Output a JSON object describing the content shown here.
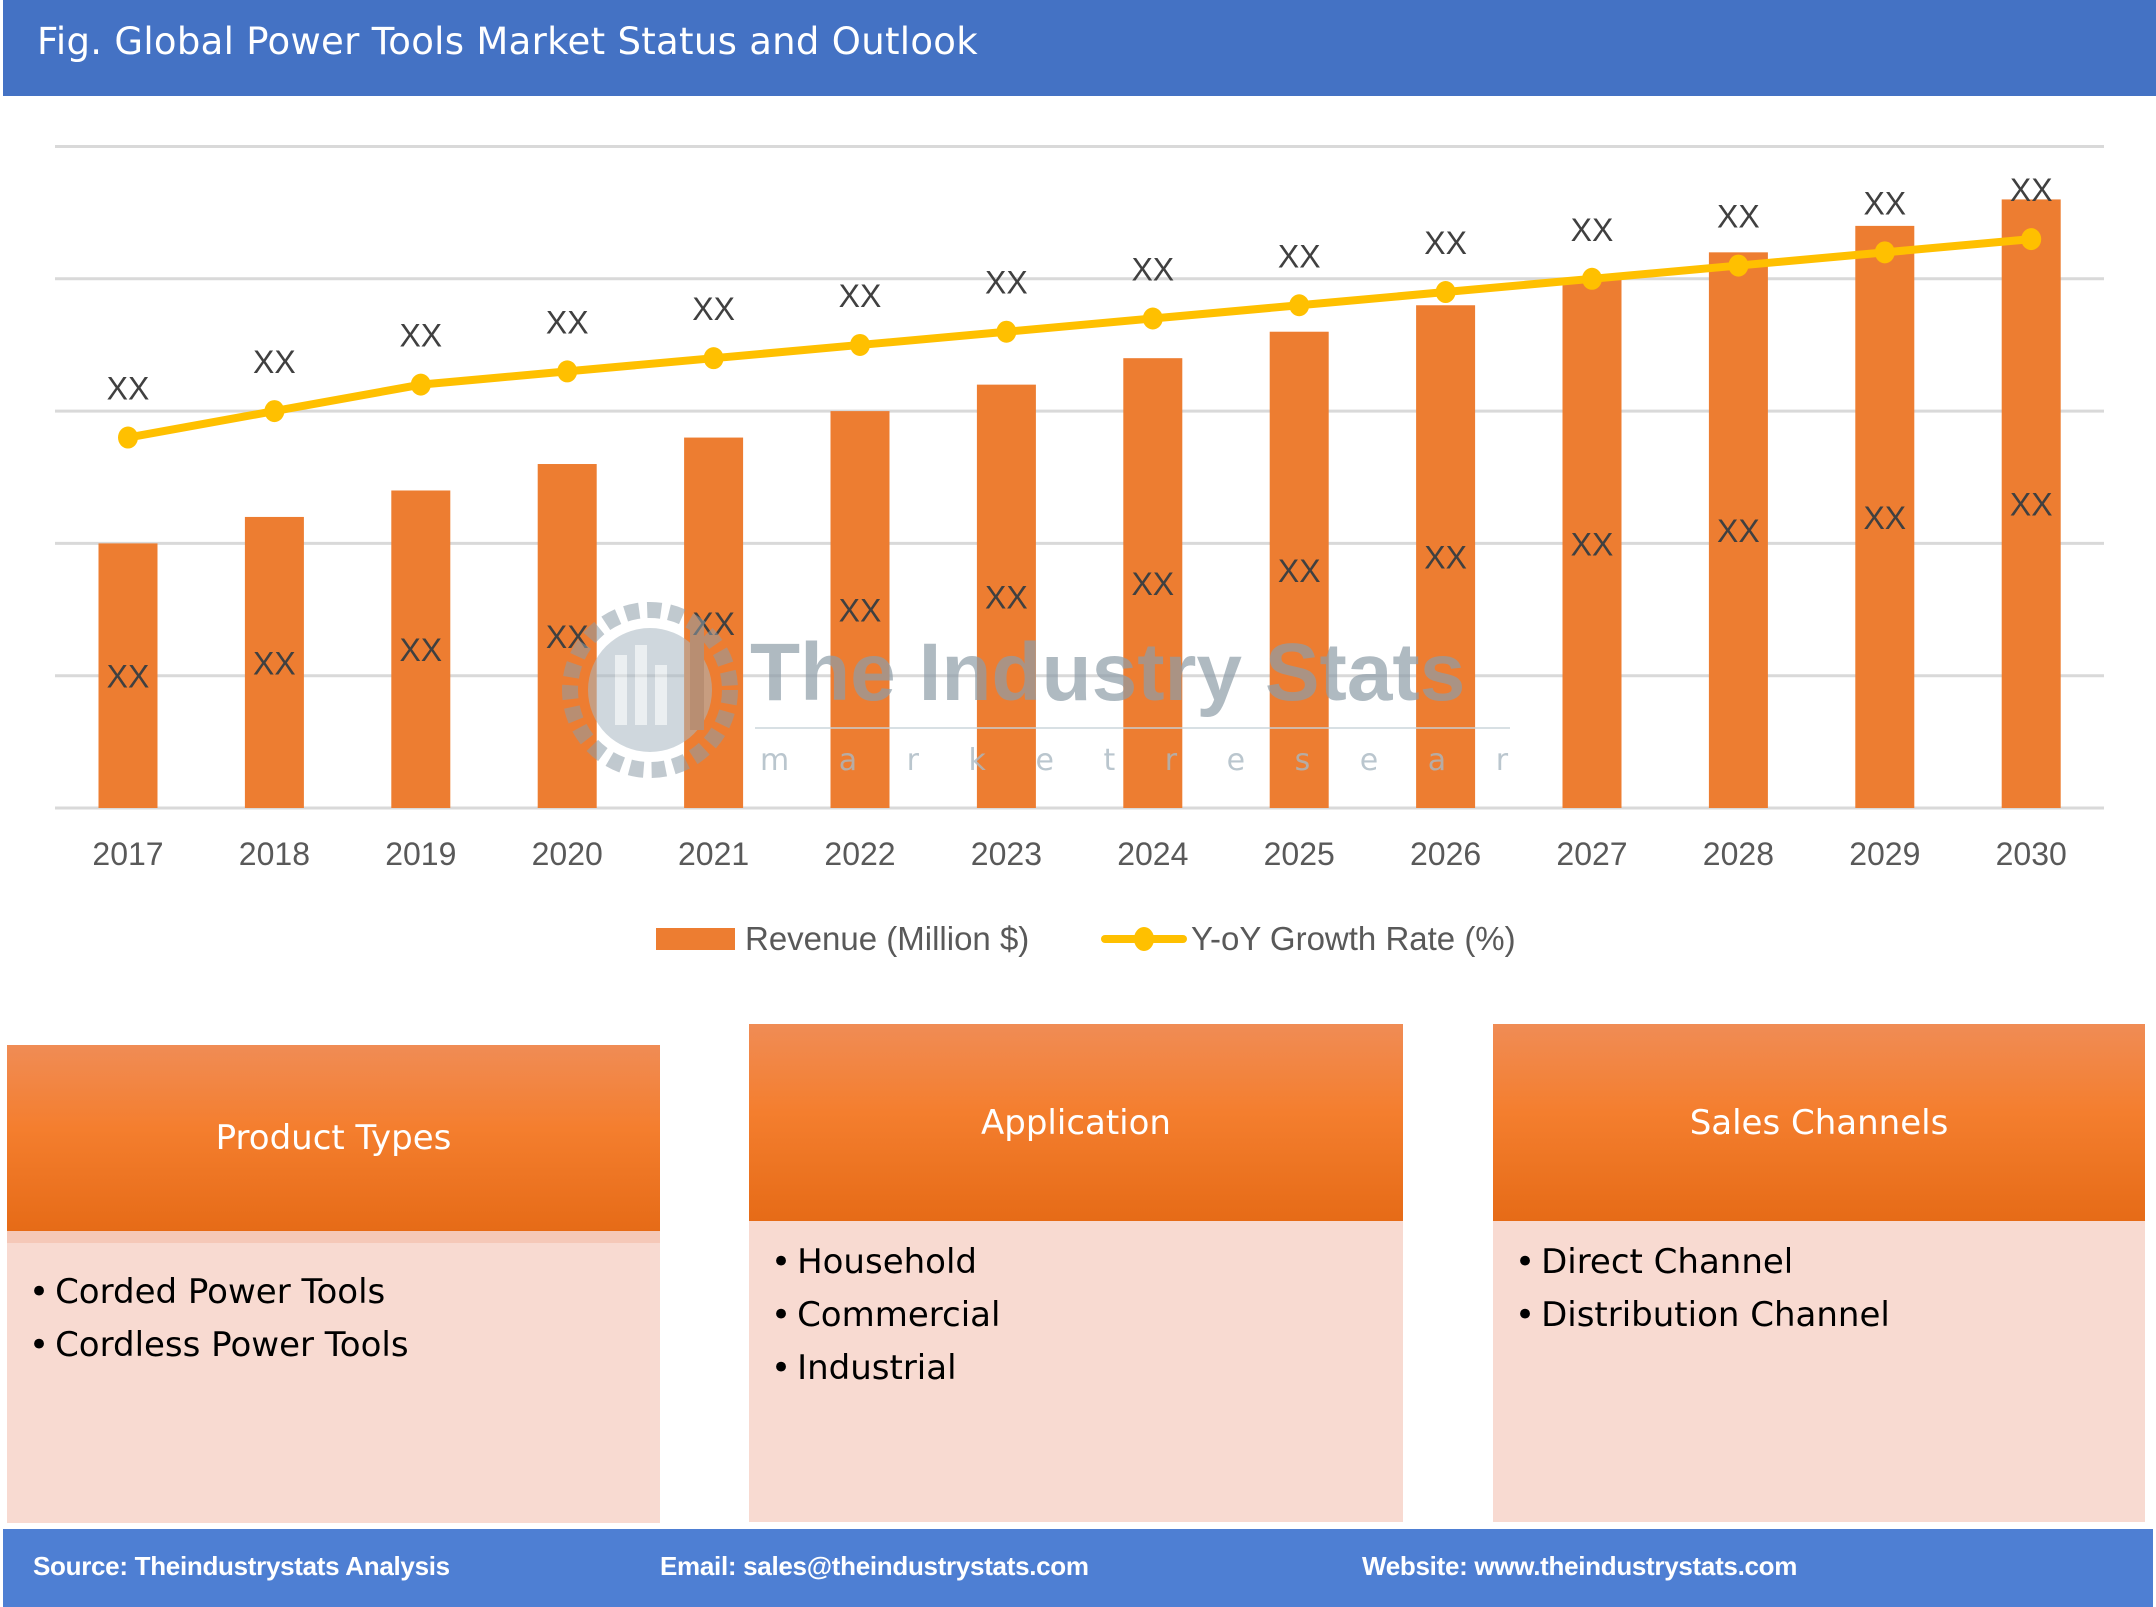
{
  "header": {
    "title": "Fig. Global Power Tools Market Status and Outlook"
  },
  "colors": {
    "header_bg": "#4472C4",
    "bar": "#ED7D31",
    "line": "#FFC000",
    "gridline": "#D9D9D9",
    "segment_body": "#F8DAD1",
    "footer_bg": "#4E7FD3"
  },
  "chart_data": {
    "type": "bar",
    "title": "",
    "xlabel": "",
    "ylabel": "",
    "categories": [
      "2017",
      "2018",
      "2019",
      "2020",
      "2021",
      "2022",
      "2023",
      "2024",
      "2025",
      "2026",
      "2027",
      "2028",
      "2029",
      "2030"
    ],
    "units_note": "Values hidden as XX; estimated in relative gridline units (baseline 0, 5 gridlines above)",
    "ylim": [
      0,
      5
    ],
    "grid": true,
    "legend_position": "bottom",
    "series": [
      {
        "name": "Revenue (Million $)",
        "type": "bar",
        "values": [
          2.0,
          2.2,
          2.4,
          2.6,
          2.8,
          3.0,
          3.2,
          3.4,
          3.6,
          3.8,
          4.0,
          4.2,
          4.4,
          4.6
        ],
        "labels": [
          "XX",
          "XX",
          "XX",
          "XX",
          "XX",
          "XX",
          "XX",
          "XX",
          "XX",
          "XX",
          "XX",
          "XX",
          "XX",
          "XX"
        ]
      },
      {
        "name": "Y-oY Growth Rate (%)",
        "type": "line",
        "values": [
          2.8,
          3.0,
          3.2,
          3.3,
          3.4,
          3.5,
          3.6,
          3.7,
          3.8,
          3.9,
          4.0,
          4.1,
          4.2,
          4.3
        ],
        "labels": [
          "XX",
          "XX",
          "XX",
          "XX",
          "XX",
          "XX",
          "XX",
          "XX",
          "XX",
          "XX",
          "XX",
          "XX",
          "XX",
          "XX"
        ]
      }
    ]
  },
  "legend": {
    "bar_label": "Revenue (Million $)",
    "line_label": "Y-oY Growth Rate (%)"
  },
  "watermark": {
    "name": "The Industry Stats",
    "tagline": "m a r k e t   r e s e a r c h"
  },
  "segments": [
    {
      "title": "Product Types",
      "items": [
        "Corded Power Tools",
        "Cordless Power Tools"
      ]
    },
    {
      "title": "Application",
      "items": [
        "Household",
        "Commercial",
        "Industrial"
      ]
    },
    {
      "title": "Sales Channels",
      "items": [
        "Direct Channel",
        "Distribution Channel"
      ]
    }
  ],
  "footer": {
    "source": "Source: Theindustrystats Analysis",
    "email": "Email: sales@theindustrystats.com",
    "website": "Website: www.theindustrystats.com"
  }
}
